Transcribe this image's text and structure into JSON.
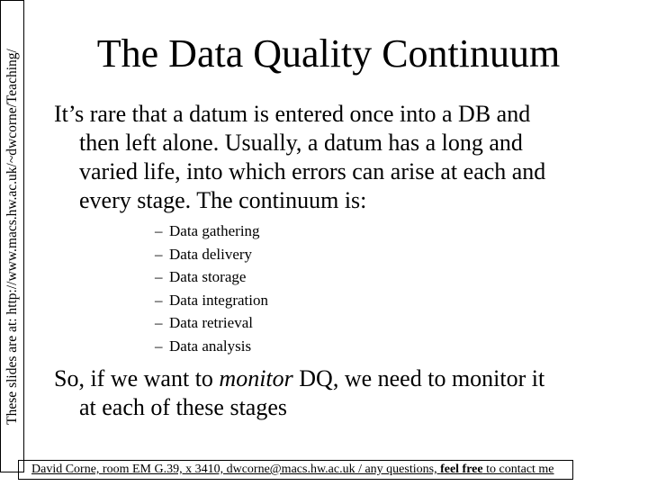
{
  "side_note": "These slides are at: http://www.macs.hw.ac.uk/~dwcorne/Teaching/",
  "title": "The Data Quality Continuum",
  "intro": {
    "lines": [
      "It’s rare that a datum is entered once into a DB and",
      "then left alone. Usually, a datum has a long and",
      "varied life, into which errors can arise at each and",
      "every stage. The continuum is:"
    ]
  },
  "stages": {
    "bullet": "–",
    "items": [
      "Data gathering",
      "Data delivery",
      "Data storage",
      "Data integration",
      "Data retrieval",
      "Data analysis"
    ]
  },
  "conclusion": {
    "before": "So, if we want to ",
    "emphasis": "monitor",
    "after": " DQ, we need to monitor it",
    "line2": "at each of these stages"
  },
  "footer": {
    "prefix": "David Corne, room EM G.39, x 3410, dwcorne@macs.hw.ac.uk / any questions, ",
    "bold": "feel free",
    "suffix": " to contact me"
  }
}
